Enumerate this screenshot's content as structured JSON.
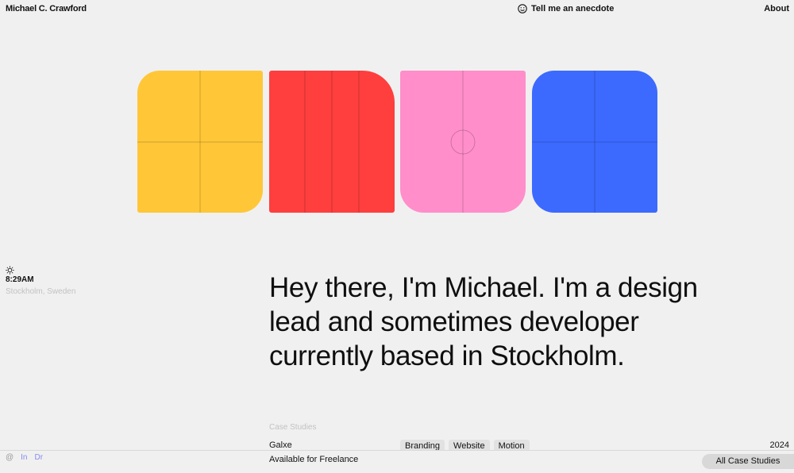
{
  "header": {
    "brand": "Michael C. Crawford",
    "anecdote_label": "Tell me an anecdote",
    "about_label": "About"
  },
  "tiles": {
    "colors": [
      "#ffc738",
      "#ff3e3e",
      "#ff8ecb",
      "#3c6aff"
    ],
    "line_color": "#555555"
  },
  "clock": {
    "icon": "sun-icon",
    "time": "8:29AM",
    "location": "Stockholm, Sweden"
  },
  "hero": {
    "line1": "Hey there, I'm Michael. I'm a design",
    "line2": "lead and sometimes developer",
    "line3": "currently based in Stockholm."
  },
  "case_studies": {
    "label": "Case Studies",
    "rows": [
      {
        "name": "Galxe",
        "tags": [
          "Branding",
          "Website",
          "Motion"
        ],
        "year": "2024"
      }
    ]
  },
  "footer": {
    "social": [
      "@",
      "In",
      "Dr"
    ],
    "status": "Available for Freelance",
    "all_case_studies": "All Case Studies"
  }
}
